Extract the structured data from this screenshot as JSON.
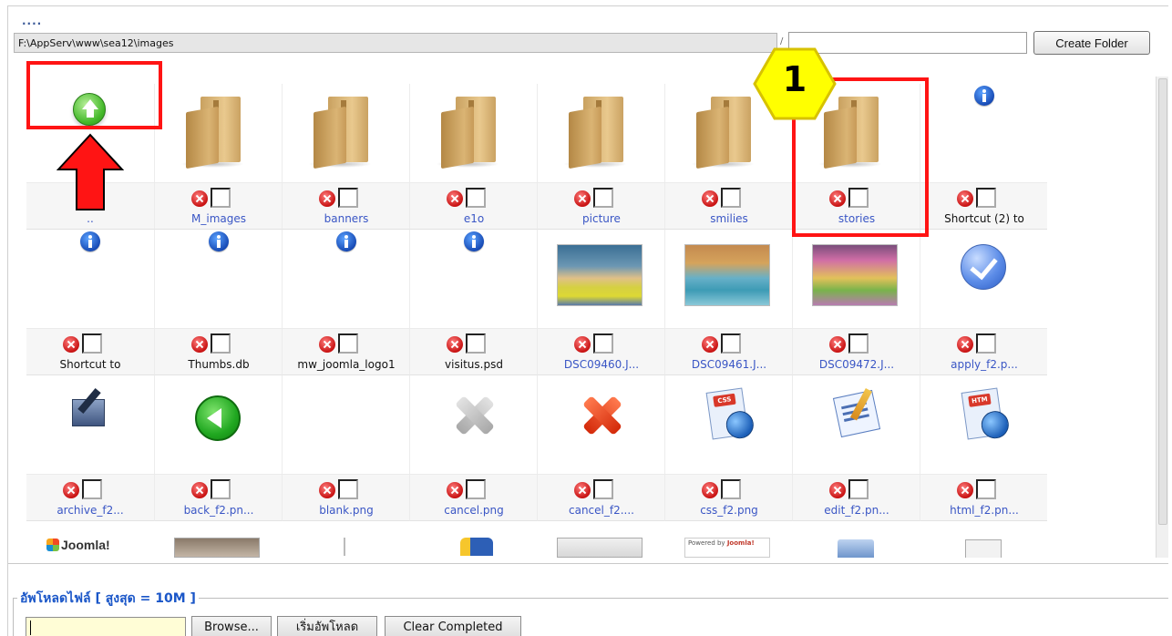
{
  "header": {
    "dots": "....",
    "current_path": "F:\\AppServ\\www\\sea12\\images",
    "path_separator": "/",
    "new_folder_value": "",
    "create_folder_label": "Create Folder"
  },
  "grid": {
    "row1": [
      {
        "name": "..",
        "icon": "up-folder-icon"
      },
      {
        "name": "M_images",
        "icon": "folder-icon"
      },
      {
        "name": "banners",
        "icon": "folder-icon"
      },
      {
        "name": "e1o",
        "icon": "folder-icon"
      },
      {
        "name": "picture",
        "icon": "folder-icon"
      },
      {
        "name": "smilies",
        "icon": "folder-icon"
      },
      {
        "name": "stories",
        "icon": "folder-icon"
      },
      {
        "name": "Shortcut (2) to",
        "icon": "info-icon"
      }
    ],
    "row2": [
      {
        "name": "Shortcut to",
        "icon": "info-icon"
      },
      {
        "name": "Thumbs.db",
        "icon": "info-icon"
      },
      {
        "name": "mw_joomla_logo1",
        "icon": "info-icon"
      },
      {
        "name": "visitus.psd",
        "icon": "info-icon"
      },
      {
        "name": "DSC09460.J...",
        "icon": "photo-thumbnail"
      },
      {
        "name": "DSC09461.J...",
        "icon": "photo-thumbnail"
      },
      {
        "name": "DSC09472.J...",
        "icon": "photo-thumbnail"
      },
      {
        "name": "apply_f2.p...",
        "icon": "check-circle-icon"
      }
    ],
    "row3": [
      {
        "name": "archive_f2...",
        "icon": "archive-icon"
      },
      {
        "name": "back_f2.pn...",
        "icon": "back-arrow-icon"
      },
      {
        "name": "blank.png",
        "icon": "blank"
      },
      {
        "name": "cancel.png",
        "icon": "grey-x-icon"
      },
      {
        "name": "cancel_f2....",
        "icon": "red-x-icon"
      },
      {
        "name": "css_f2.png",
        "icon": "css-document-icon"
      },
      {
        "name": "edit_f2.pn...",
        "icon": "edit-document-icon"
      },
      {
        "name": "html_f2.pn...",
        "icon": "html-document-icon"
      }
    ],
    "row4_partial": {
      "joomla_logo_text": "Joomla!",
      "badge_text": "Powered by",
      "badge_logo_text": "Joomla!"
    },
    "css_tag": "CSS",
    "html_tag": "HTM"
  },
  "upload": {
    "legend": "อัพโหลดไฟล์ [ สูงสุด = 10M ]",
    "browse_label": "Browse...",
    "start_upload_label": "เริ่มอัพโหลด",
    "clear_completed_label": "Clear Completed"
  },
  "annotation": {
    "badge_number": "1",
    "highlight_color": "#ff1414",
    "badge_color": "#ffff00"
  }
}
